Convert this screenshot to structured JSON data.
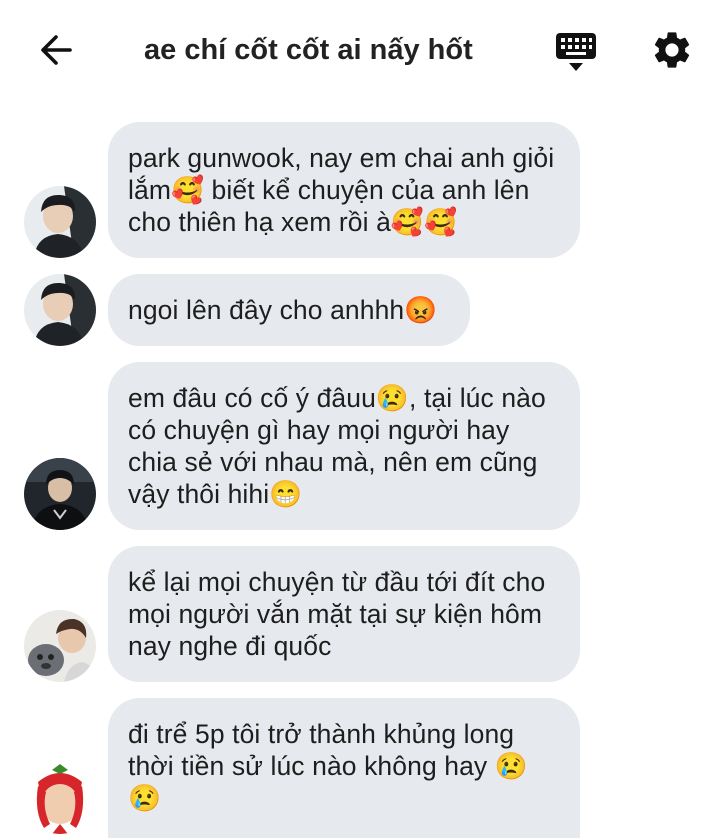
{
  "header": {
    "title": "ae chí cốt cốt ai nấy hốt",
    "back_icon": "arrow-left-icon",
    "keyboard_icon": "keyboard-icon",
    "settings_icon": "gear-icon"
  },
  "messages": [
    {
      "avatar": "avatar-dark-hair-boy",
      "text": "park gunwook, nay em chai anh giỏi lắm🥰 biết kể chuyện của anh lên cho thiên hạ xem rồi à🥰🥰"
    },
    {
      "avatar": "avatar-dark-hair-boy",
      "text": "ngoi lên đây cho anhhh😡"
    },
    {
      "avatar": "avatar-dark-jacket-boy",
      "text": "em đâu có cố ý đâuu😢, tại lúc nào có chuyện gì hay mọi người hay chia sẻ với nhau mà, nên em cũng vậy thôi hihi😁"
    },
    {
      "avatar": "avatar-boy-with-dog",
      "text": "kể lại mọi chuyện từ đầu tới đít cho mọi người vắn mặt tại sự kiện hôm nay nghe đi quốc"
    },
    {
      "avatar": "avatar-strawberry-hat",
      "text": "đi trể 5p tôi trở thành khủng long thời tiền sử lúc nào không hay 😢 😢"
    }
  ]
}
